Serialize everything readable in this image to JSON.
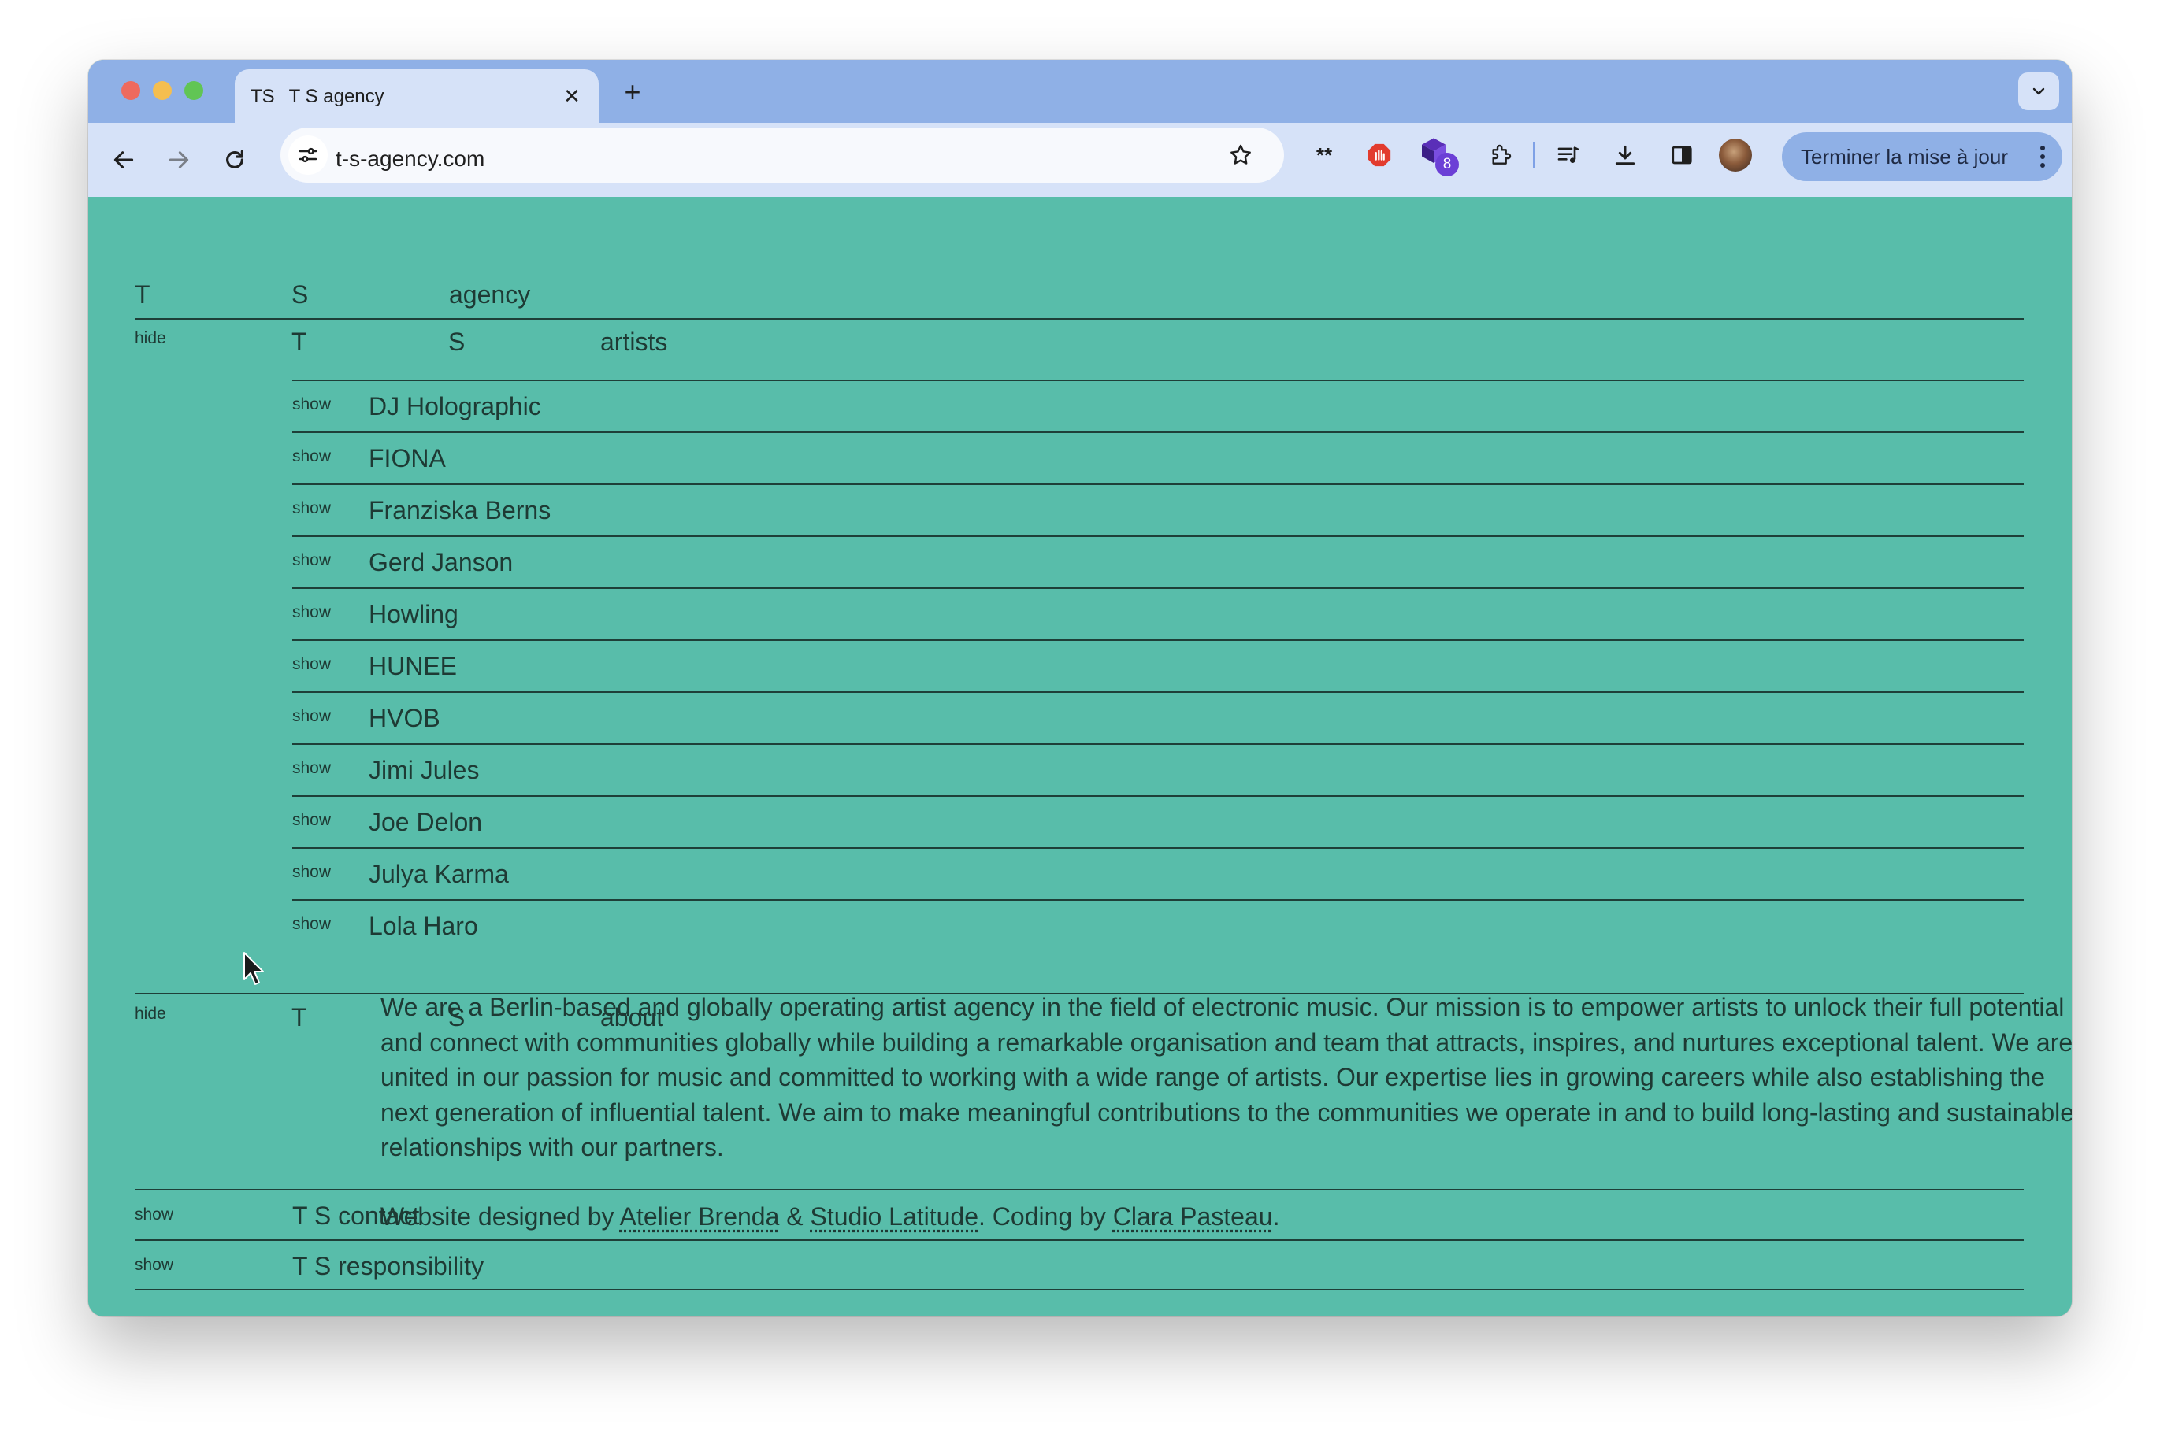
{
  "browser": {
    "tab": {
      "favicon_text": "TS",
      "title": "T S agency"
    },
    "url": "t-s-agency.com",
    "update_button": "Terminer la mise à jour",
    "extension_badge": "8"
  },
  "header": {
    "letter_t": "T",
    "letter_s": "S",
    "word": "agency"
  },
  "artists_section": {
    "toggle": "hide",
    "letter_t": "T",
    "letter_s": "S",
    "title": "artists",
    "show_label": "show",
    "items": [
      "DJ Holographic",
      "FIONA",
      "Franziska Berns",
      "Gerd Janson",
      "Howling",
      "HUNEE",
      "HVOB",
      "Jimi Jules",
      "Joe Delon",
      "Julya Karma",
      "Lola Haro"
    ]
  },
  "about_section": {
    "toggle": "hide",
    "letter_t": "T",
    "letter_s": "S",
    "title": "about",
    "paragraph": "We are a Berlin-based and globally operating artist agency in the field of electronic music. Our mission is to empower artists to unlock their full potential and connect with communities globally while building a remarkable organisation and team that attracts, inspires, and nurtures exceptional talent. We are united in our passion for music and committed to working with a wide range of artists. Our expertise lies in growing careers while also establishing the next generation of influential talent. We aim to make meaningful contributions to the communities we operate in and to build long-lasting and sustainable relationships with our partners.",
    "credits": {
      "prefix": "Website designed by ",
      "link1": "Atelier Brenda",
      "amp": " & ",
      "link2": "Studio Latitude",
      "middle": ". Coding by ",
      "link3": "Clara Pasteau",
      "suffix": "."
    }
  },
  "contact_section": {
    "toggle": "show",
    "title": "T S contact"
  },
  "responsibility_section": {
    "toggle": "show",
    "title": "T S responsibility"
  },
  "colors": {
    "page_background": "#58bdaa",
    "text": "#1e3a34",
    "browser_frame": "#8fb0e6",
    "toolbar": "#d6e2f8"
  },
  "icons": [
    "back-icon",
    "forward-icon",
    "reload-icon",
    "site-settings-icon",
    "star-icon",
    "extension-icon",
    "download-icon",
    "side-panel-icon",
    "media-icon",
    "profile-avatar"
  ]
}
